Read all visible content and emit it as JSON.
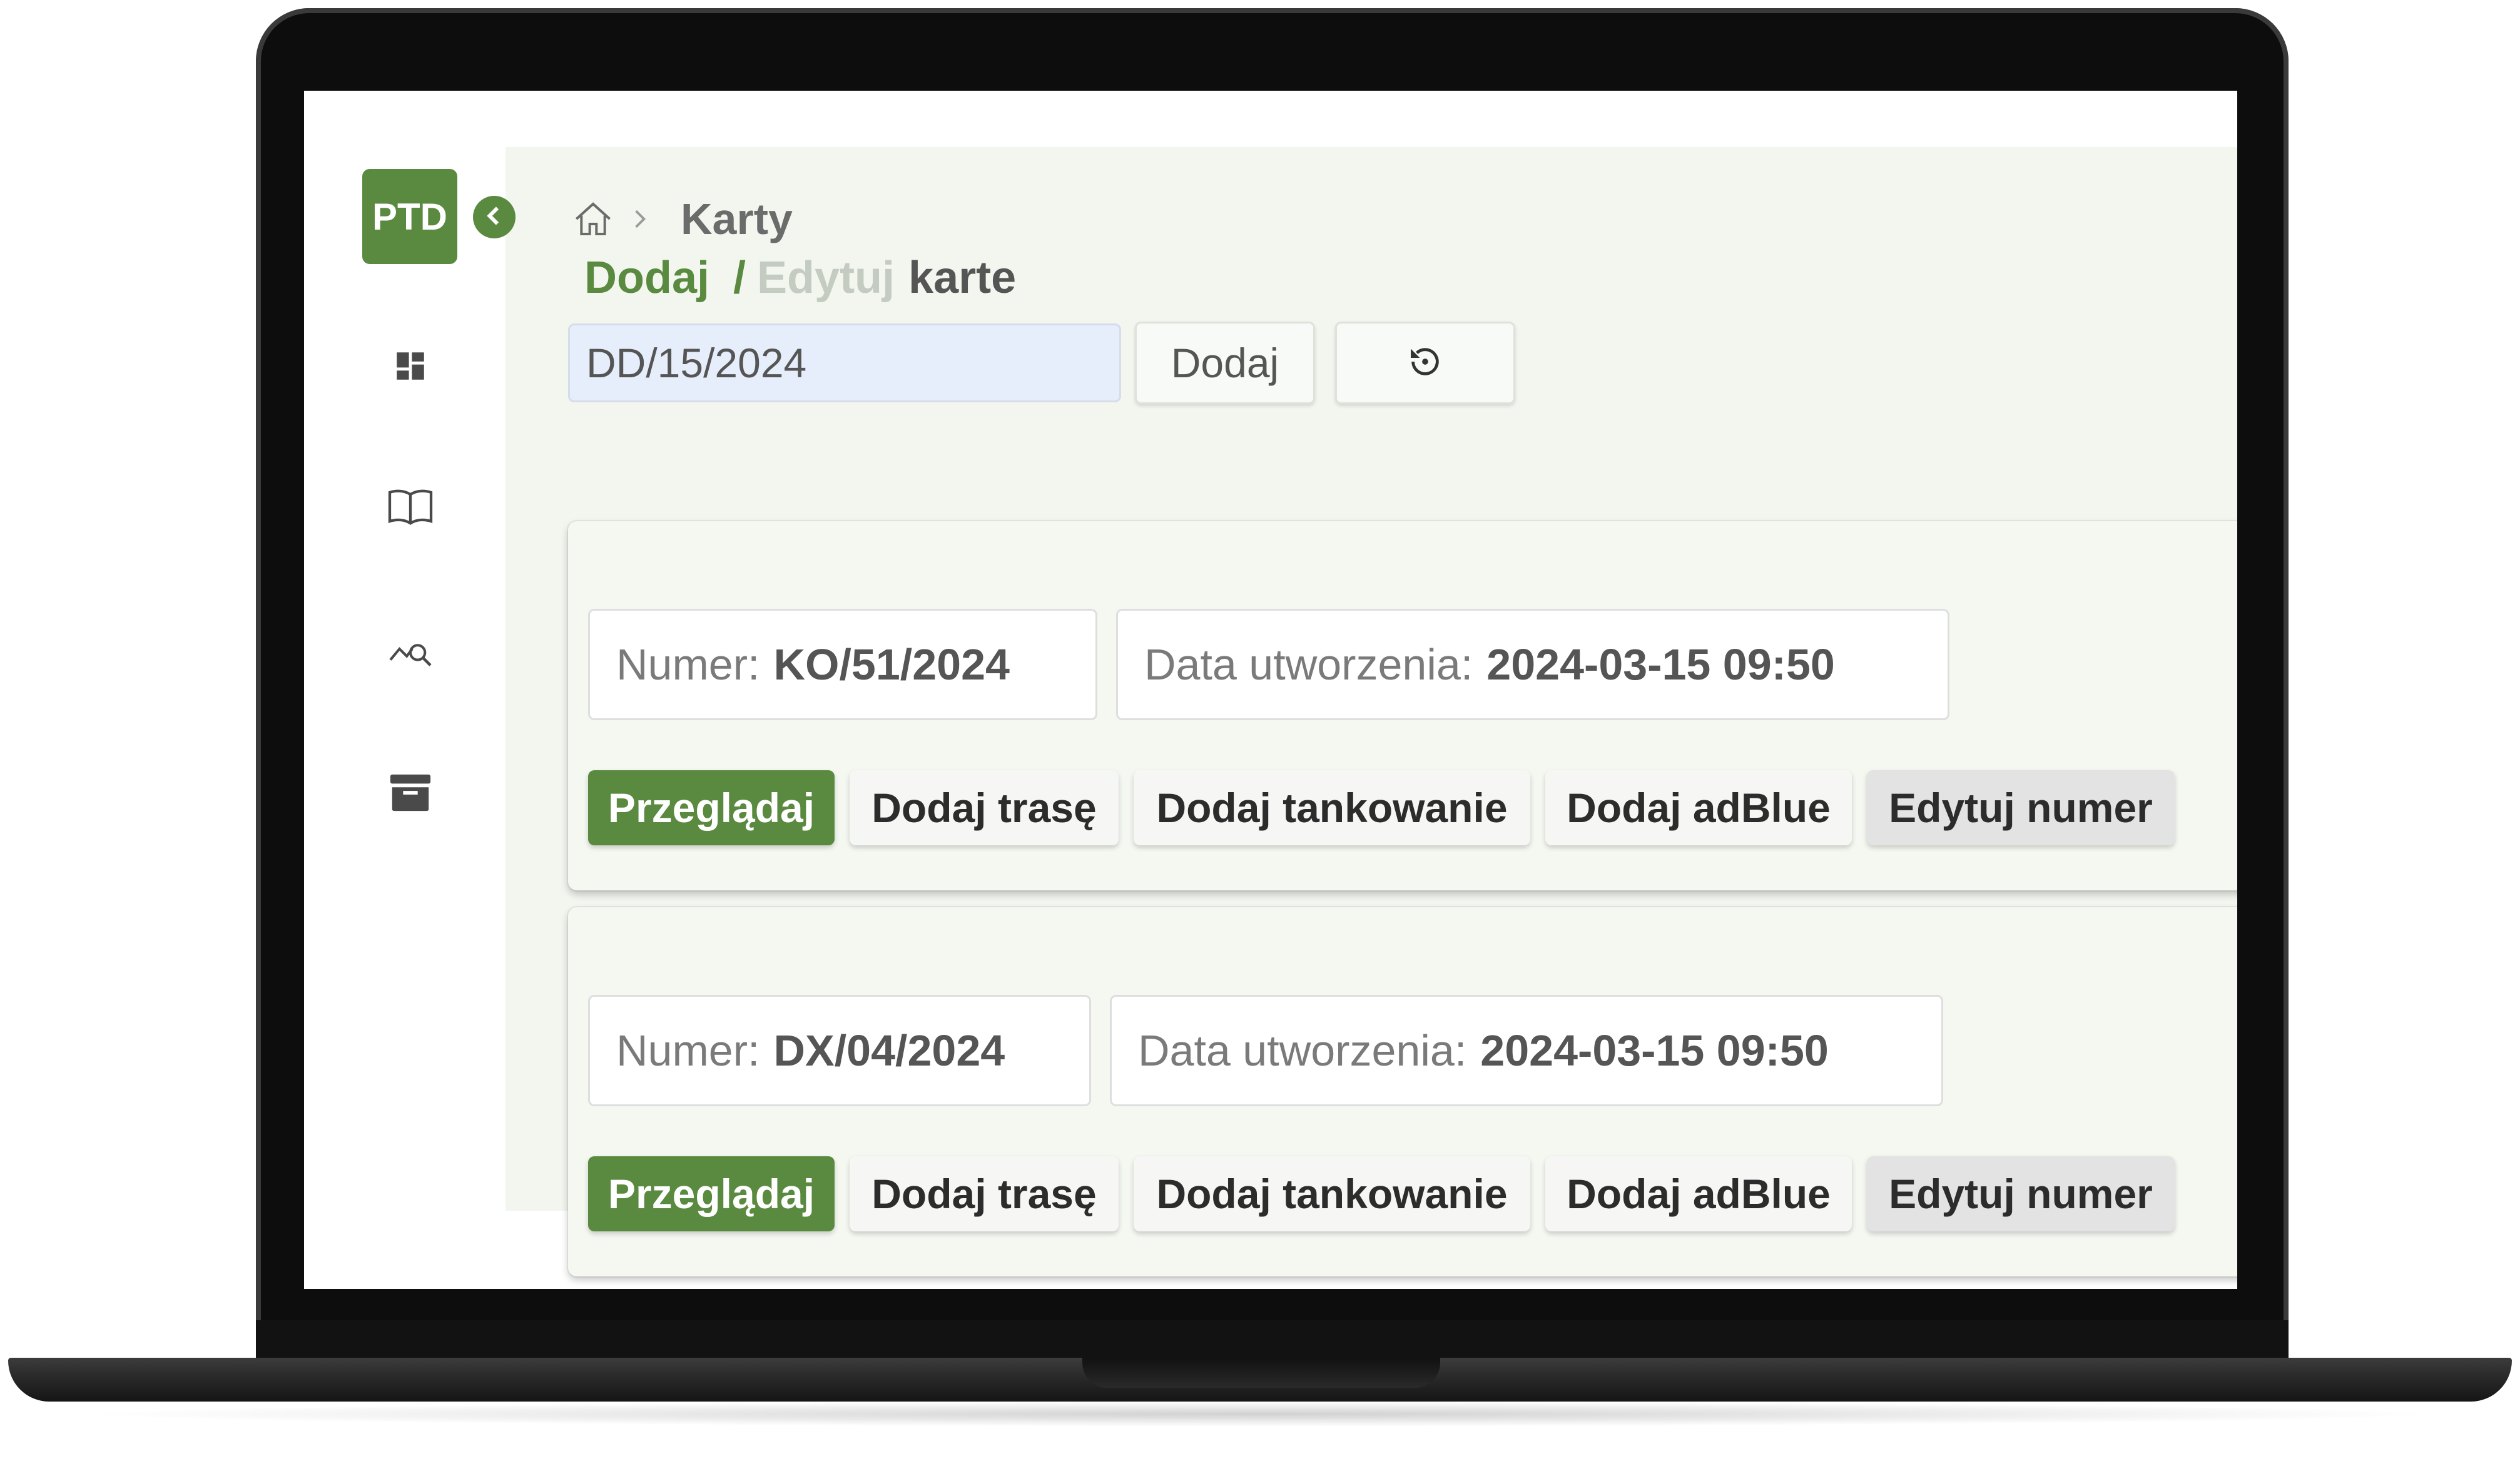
{
  "app": {
    "logo_text": "PTD"
  },
  "sidebar": {
    "items": [
      {
        "icon": "dashboard-icon"
      },
      {
        "icon": "book-icon"
      },
      {
        "icon": "chart-search-icon"
      },
      {
        "icon": "archive-icon"
      }
    ]
  },
  "breadcrumb": {
    "home_icon": "home-icon",
    "current": "Karty"
  },
  "title": {
    "add": "Dodaj",
    "separator": "/",
    "edit": "Edytuj",
    "object": "karte"
  },
  "toolbar": {
    "date_value": "DD/15/2024",
    "add_label": "Dodaj",
    "reset_icon": "history-icon"
  },
  "cards": [
    {
      "number_label": "Numer:",
      "number_value": "KO/51/2024",
      "created_label": "Data utworzenia:",
      "created_value": "2024-03-15 09:50",
      "actions": [
        "Przeglądaj",
        "Dodaj trasę",
        "Dodaj tankowanie",
        "Dodaj adBlue",
        "Edytuj numer"
      ]
    },
    {
      "number_label": "Numer:",
      "number_value": "DX/04/2024",
      "created_label": "Data utworzenia:",
      "created_value": "2024-03-15 09:50",
      "actions": [
        "Przeglądaj",
        "Dodaj trasę",
        "Dodaj tankowanie",
        "Dodaj adBlue",
        "Edytuj numer"
      ]
    }
  ],
  "colors": {
    "accent": "#5a8a3f",
    "content_bg": "#f2f6ef",
    "input_bg": "#e6eefb"
  }
}
